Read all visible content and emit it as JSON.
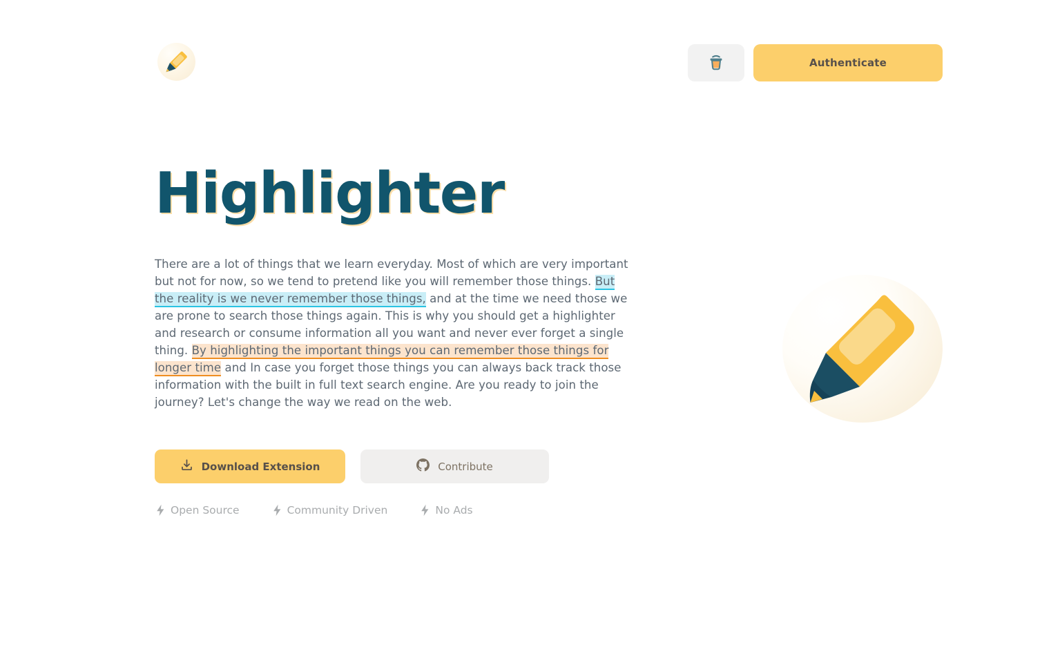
{
  "brand": {
    "logo_icon": "highlighter-pen-icon",
    "name": "Highlighter"
  },
  "topbar": {
    "coffee_button": {
      "icon": "coffee-cup-icon",
      "label": ""
    },
    "auth_button": {
      "label": "Authenticate"
    }
  },
  "hero": {
    "title": "Highlighter",
    "body": {
      "part1": "There are a lot of things that we learn everyday. Most of which are very important but not for now, so we tend to pretend like you will remember those things. ",
      "highlight_cyan": "But the reality is we never remember those things,",
      "part2": " and at the time we need those we are prone to search those things again. This is why you should get a highlighter and research or consume information all you want and never ever forget a single thing. ",
      "highlight_orange": "By highlighting the important things you can remember those things for longer time",
      "part3": " and In case you forget those things you can always back track those information with the built in full text search engine. Are you ready to join the journey? Let's change the way we read on the web."
    },
    "illustration_icon": "highlighter-marker-illustration"
  },
  "cta": {
    "primary": {
      "label": "Download Extension",
      "icon": "download-icon"
    },
    "secondary": {
      "label": "Contribute",
      "icon": "github-icon"
    }
  },
  "features": [
    {
      "icon": "lightning-bolt-icon",
      "label": "Open Source"
    },
    {
      "icon": "lightning-bolt-icon",
      "label": "Community Driven"
    },
    {
      "icon": "lightning-bolt-icon",
      "label": "No Ads"
    }
  ],
  "colors": {
    "accent_yellow": "#fccf6b",
    "title_teal": "#11556c",
    "body_gray": "#5d6873",
    "highlight_cyan_bg": "#c9eef7",
    "highlight_cyan_line": "#2bc3e2",
    "highlight_orange_bg": "#fce4cd",
    "highlight_orange_line": "#ef8e21",
    "secondary_bg": "#f0efee",
    "marker_body": "#f9bf3e",
    "marker_tip": "#1b4e63"
  }
}
